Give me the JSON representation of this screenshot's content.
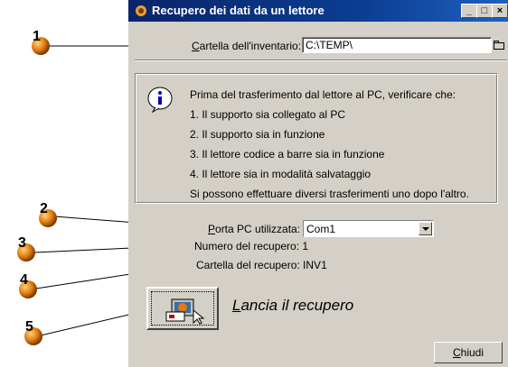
{
  "window": {
    "title": "Recupero dei dati da un lettore",
    "title_buttons": [
      "_",
      "□",
      "×"
    ]
  },
  "inventory": {
    "label": "Cartella dell'inventario:",
    "label_access_key": "C",
    "value": "C:\\TEMP\\"
  },
  "info": {
    "lines": [
      "Prima del trasferimento dal lettore al PC, verificare che:",
      "1. Il supporto sia collegato al PC",
      "2. Il supporto sia in funzione",
      "3. Il lettore codice a barre sia in funzione",
      "4. Il lettore sia in modalità salvataggio",
      "Si possono effettuare diversi trasferimenti uno dopo l'altro."
    ]
  },
  "port": {
    "label": "Porta PC utilizzata:",
    "value": "Com1"
  },
  "recovery_number": "Numero del recupero: 1",
  "recovery_folder": "Cartella del recupero: INV1",
  "launch_label": "Lancia il recupero",
  "close_label": "Chiudi",
  "callouts": [
    "1",
    "2",
    "3",
    "4",
    "5"
  ],
  "colors": {
    "titlebar": "#0a246a",
    "window_bg": "#d4d0c8",
    "callout_ball": "#e07a10"
  }
}
